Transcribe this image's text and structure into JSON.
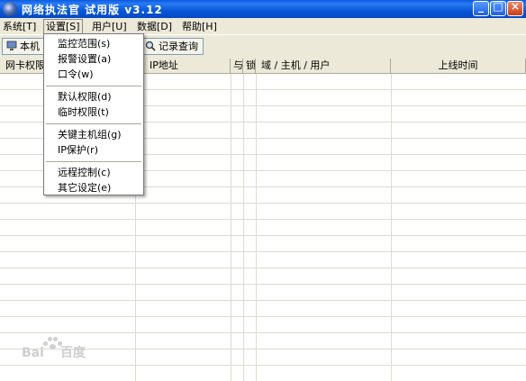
{
  "window": {
    "title": "网络执法官  试用版  v3.12"
  },
  "menubar": [
    {
      "label": "系统[T]"
    },
    {
      "label": "设置[S]"
    },
    {
      "label": "用户[U]"
    },
    {
      "label": "数据[D]"
    },
    {
      "label": "帮助[H]"
    }
  ],
  "toolbar": {
    "btn1": "本机",
    "btn2": "记录查询"
  },
  "table": {
    "columns": [
      "网卡权限",
      "IP地址",
      "与",
      "锁",
      "域 / 主机 / 用户",
      "上线时间"
    ]
  },
  "settings_menu": {
    "items": [
      "监控范围(s)",
      "报警设置(a)",
      "口令(w)",
      "默认权限(d)",
      "临时权限(t)",
      "关键主机组(g)",
      "IP保护(r)",
      "远程控制(c)",
      "其它设定(e)"
    ]
  },
  "watermark": {
    "text": "Bai",
    "text2": "百度"
  },
  "colors": {
    "titlebar": "#0758d8",
    "chrome": "#ece9d8",
    "close": "#c93c1a"
  },
  "icons": {
    "app": "network-globe-icon",
    "local": "computer-icon",
    "records": "search-icon"
  }
}
